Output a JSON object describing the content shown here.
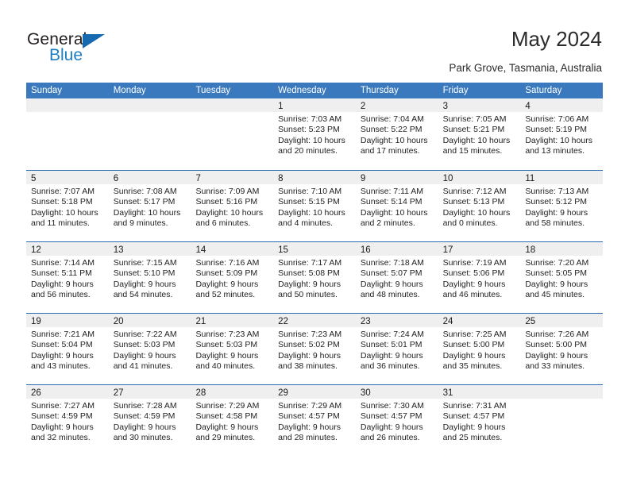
{
  "brand": {
    "name_top": "General",
    "name_bottom": "Blue"
  },
  "header": {
    "title": "May 2024",
    "subtitle": "Park Grove, Tasmania, Australia"
  },
  "colors": {
    "header_blue": "#3a79bd",
    "row_divider_blue": "#2a6db4",
    "day_band_gray": "#efefef",
    "brand_blue": "#1b7ec4"
  },
  "weekdays": [
    "Sunday",
    "Monday",
    "Tuesday",
    "Wednesday",
    "Thursday",
    "Friday",
    "Saturday"
  ],
  "labels": {
    "sunrise": "Sunrise:",
    "sunset": "Sunset:",
    "daylight": "Daylight:"
  },
  "weeks": [
    [
      {
        "day": "",
        "sunrise": "",
        "sunset": "",
        "daylight_1": "",
        "daylight_2": "",
        "empty": true
      },
      {
        "day": "",
        "sunrise": "",
        "sunset": "",
        "daylight_1": "",
        "daylight_2": "",
        "empty": true
      },
      {
        "day": "",
        "sunrise": "",
        "sunset": "",
        "daylight_1": "",
        "daylight_2": "",
        "empty": true
      },
      {
        "day": "1",
        "sunrise": "Sunrise: 7:03 AM",
        "sunset": "Sunset: 5:23 PM",
        "daylight_1": "Daylight: 10 hours",
        "daylight_2": "and 20 minutes.",
        "empty": false
      },
      {
        "day": "2",
        "sunrise": "Sunrise: 7:04 AM",
        "sunset": "Sunset: 5:22 PM",
        "daylight_1": "Daylight: 10 hours",
        "daylight_2": "and 17 minutes.",
        "empty": false
      },
      {
        "day": "3",
        "sunrise": "Sunrise: 7:05 AM",
        "sunset": "Sunset: 5:21 PM",
        "daylight_1": "Daylight: 10 hours",
        "daylight_2": "and 15 minutes.",
        "empty": false
      },
      {
        "day": "4",
        "sunrise": "Sunrise: 7:06 AM",
        "sunset": "Sunset: 5:19 PM",
        "daylight_1": "Daylight: 10 hours",
        "daylight_2": "and 13 minutes.",
        "empty": false
      }
    ],
    [
      {
        "day": "5",
        "sunrise": "Sunrise: 7:07 AM",
        "sunset": "Sunset: 5:18 PM",
        "daylight_1": "Daylight: 10 hours",
        "daylight_2": "and 11 minutes.",
        "empty": false
      },
      {
        "day": "6",
        "sunrise": "Sunrise: 7:08 AM",
        "sunset": "Sunset: 5:17 PM",
        "daylight_1": "Daylight: 10 hours",
        "daylight_2": "and 9 minutes.",
        "empty": false
      },
      {
        "day": "7",
        "sunrise": "Sunrise: 7:09 AM",
        "sunset": "Sunset: 5:16 PM",
        "daylight_1": "Daylight: 10 hours",
        "daylight_2": "and 6 minutes.",
        "empty": false
      },
      {
        "day": "8",
        "sunrise": "Sunrise: 7:10 AM",
        "sunset": "Sunset: 5:15 PM",
        "daylight_1": "Daylight: 10 hours",
        "daylight_2": "and 4 minutes.",
        "empty": false
      },
      {
        "day": "9",
        "sunrise": "Sunrise: 7:11 AM",
        "sunset": "Sunset: 5:14 PM",
        "daylight_1": "Daylight: 10 hours",
        "daylight_2": "and 2 minutes.",
        "empty": false
      },
      {
        "day": "10",
        "sunrise": "Sunrise: 7:12 AM",
        "sunset": "Sunset: 5:13 PM",
        "daylight_1": "Daylight: 10 hours",
        "daylight_2": "and 0 minutes.",
        "empty": false
      },
      {
        "day": "11",
        "sunrise": "Sunrise: 7:13 AM",
        "sunset": "Sunset: 5:12 PM",
        "daylight_1": "Daylight: 9 hours",
        "daylight_2": "and 58 minutes.",
        "empty": false
      }
    ],
    [
      {
        "day": "12",
        "sunrise": "Sunrise: 7:14 AM",
        "sunset": "Sunset: 5:11 PM",
        "daylight_1": "Daylight: 9 hours",
        "daylight_2": "and 56 minutes.",
        "empty": false
      },
      {
        "day": "13",
        "sunrise": "Sunrise: 7:15 AM",
        "sunset": "Sunset: 5:10 PM",
        "daylight_1": "Daylight: 9 hours",
        "daylight_2": "and 54 minutes.",
        "empty": false
      },
      {
        "day": "14",
        "sunrise": "Sunrise: 7:16 AM",
        "sunset": "Sunset: 5:09 PM",
        "daylight_1": "Daylight: 9 hours",
        "daylight_2": "and 52 minutes.",
        "empty": false
      },
      {
        "day": "15",
        "sunrise": "Sunrise: 7:17 AM",
        "sunset": "Sunset: 5:08 PM",
        "daylight_1": "Daylight: 9 hours",
        "daylight_2": "and 50 minutes.",
        "empty": false
      },
      {
        "day": "16",
        "sunrise": "Sunrise: 7:18 AM",
        "sunset": "Sunset: 5:07 PM",
        "daylight_1": "Daylight: 9 hours",
        "daylight_2": "and 48 minutes.",
        "empty": false
      },
      {
        "day": "17",
        "sunrise": "Sunrise: 7:19 AM",
        "sunset": "Sunset: 5:06 PM",
        "daylight_1": "Daylight: 9 hours",
        "daylight_2": "and 46 minutes.",
        "empty": false
      },
      {
        "day": "18",
        "sunrise": "Sunrise: 7:20 AM",
        "sunset": "Sunset: 5:05 PM",
        "daylight_1": "Daylight: 9 hours",
        "daylight_2": "and 45 minutes.",
        "empty": false
      }
    ],
    [
      {
        "day": "19",
        "sunrise": "Sunrise: 7:21 AM",
        "sunset": "Sunset: 5:04 PM",
        "daylight_1": "Daylight: 9 hours",
        "daylight_2": "and 43 minutes.",
        "empty": false
      },
      {
        "day": "20",
        "sunrise": "Sunrise: 7:22 AM",
        "sunset": "Sunset: 5:03 PM",
        "daylight_1": "Daylight: 9 hours",
        "daylight_2": "and 41 minutes.",
        "empty": false
      },
      {
        "day": "21",
        "sunrise": "Sunrise: 7:23 AM",
        "sunset": "Sunset: 5:03 PM",
        "daylight_1": "Daylight: 9 hours",
        "daylight_2": "and 40 minutes.",
        "empty": false
      },
      {
        "day": "22",
        "sunrise": "Sunrise: 7:23 AM",
        "sunset": "Sunset: 5:02 PM",
        "daylight_1": "Daylight: 9 hours",
        "daylight_2": "and 38 minutes.",
        "empty": false
      },
      {
        "day": "23",
        "sunrise": "Sunrise: 7:24 AM",
        "sunset": "Sunset: 5:01 PM",
        "daylight_1": "Daylight: 9 hours",
        "daylight_2": "and 36 minutes.",
        "empty": false
      },
      {
        "day": "24",
        "sunrise": "Sunrise: 7:25 AM",
        "sunset": "Sunset: 5:00 PM",
        "daylight_1": "Daylight: 9 hours",
        "daylight_2": "and 35 minutes.",
        "empty": false
      },
      {
        "day": "25",
        "sunrise": "Sunrise: 7:26 AM",
        "sunset": "Sunset: 5:00 PM",
        "daylight_1": "Daylight: 9 hours",
        "daylight_2": "and 33 minutes.",
        "empty": false
      }
    ],
    [
      {
        "day": "26",
        "sunrise": "Sunrise: 7:27 AM",
        "sunset": "Sunset: 4:59 PM",
        "daylight_1": "Daylight: 9 hours",
        "daylight_2": "and 32 minutes.",
        "empty": false
      },
      {
        "day": "27",
        "sunrise": "Sunrise: 7:28 AM",
        "sunset": "Sunset: 4:59 PM",
        "daylight_1": "Daylight: 9 hours",
        "daylight_2": "and 30 minutes.",
        "empty": false
      },
      {
        "day": "28",
        "sunrise": "Sunrise: 7:29 AM",
        "sunset": "Sunset: 4:58 PM",
        "daylight_1": "Daylight: 9 hours",
        "daylight_2": "and 29 minutes.",
        "empty": false
      },
      {
        "day": "29",
        "sunrise": "Sunrise: 7:29 AM",
        "sunset": "Sunset: 4:57 PM",
        "daylight_1": "Daylight: 9 hours",
        "daylight_2": "and 28 minutes.",
        "empty": false
      },
      {
        "day": "30",
        "sunrise": "Sunrise: 7:30 AM",
        "sunset": "Sunset: 4:57 PM",
        "daylight_1": "Daylight: 9 hours",
        "daylight_2": "and 26 minutes.",
        "empty": false
      },
      {
        "day": "31",
        "sunrise": "Sunrise: 7:31 AM",
        "sunset": "Sunset: 4:57 PM",
        "daylight_1": "Daylight: 9 hours",
        "daylight_2": "and 25 minutes.",
        "empty": false
      },
      {
        "day": "",
        "sunrise": "",
        "sunset": "",
        "daylight_1": "",
        "daylight_2": "",
        "empty": true
      }
    ]
  ]
}
